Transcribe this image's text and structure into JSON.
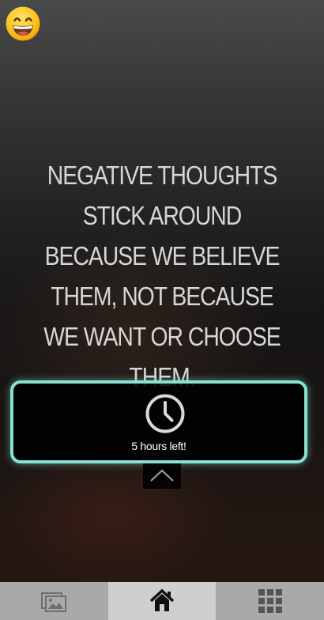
{
  "quote": {
    "text": "NEGATIVE THOUGHTS STICK AROUND BECAUSE WE BELIEVE THEM, NOT BECAUSE WE WANT OR CHOOSE THEM."
  },
  "timer": {
    "icon": "clock-icon",
    "text": "5 hours left!",
    "accent_color": "#86e3d1"
  },
  "mood": {
    "icon": "grinning-face-emoji"
  },
  "tabbar": {
    "tabs": [
      {
        "icon": "photo-gallery-icon",
        "active": false
      },
      {
        "icon": "home-icon",
        "active": true
      },
      {
        "icon": "grid-icon",
        "active": false
      }
    ],
    "active_bg": "#cfcfcf",
    "inactive_bg": "#a9a9a9"
  }
}
